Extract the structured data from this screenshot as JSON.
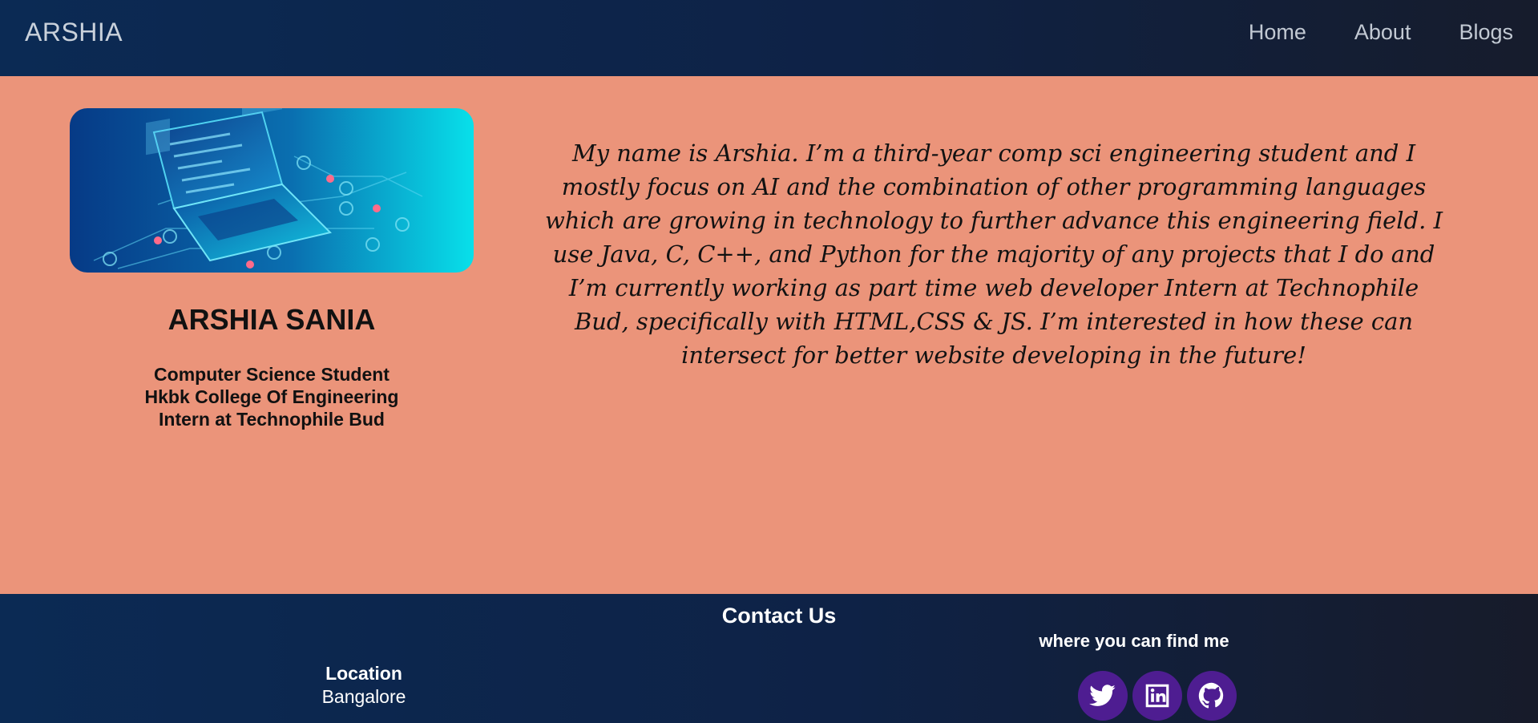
{
  "nav": {
    "brand": "ARSHIA",
    "links": [
      "Home",
      "About",
      "Blogs"
    ]
  },
  "profile": {
    "image_icon": "laptop-circuit-illustration",
    "name": "ARSHIA SANIA",
    "lines": [
      "Computer Science Student",
      "Hkbk College Of Engineering",
      "Intern at Technophile Bud"
    ]
  },
  "about": {
    "text": "My name is Arshia. I’m a third-year comp sci engineering student and I mostly focus on AI and the combination of other programming languages which are growing in technology to further advance this engineering field. I use Java, C, C++, and Python for the majority of any projects that I do and I’m currently working as part time web developer Intern at Technophile Bud, specifically with HTML,CSS & JS. I’m interested in how these can intersect for better website developing in the future!"
  },
  "footer": {
    "title": "Contact Us",
    "location_label": "Location",
    "location_value": "Bangalore",
    "find_me": "where you can find me",
    "socials": [
      "twitter-icon",
      "linkedin-icon",
      "github-icon"
    ]
  },
  "colors": {
    "background": "#eb947a",
    "nav_gradient_start": "#0b2a54",
    "nav_gradient_end": "#161c2c",
    "social_button": "#4e1d91"
  }
}
